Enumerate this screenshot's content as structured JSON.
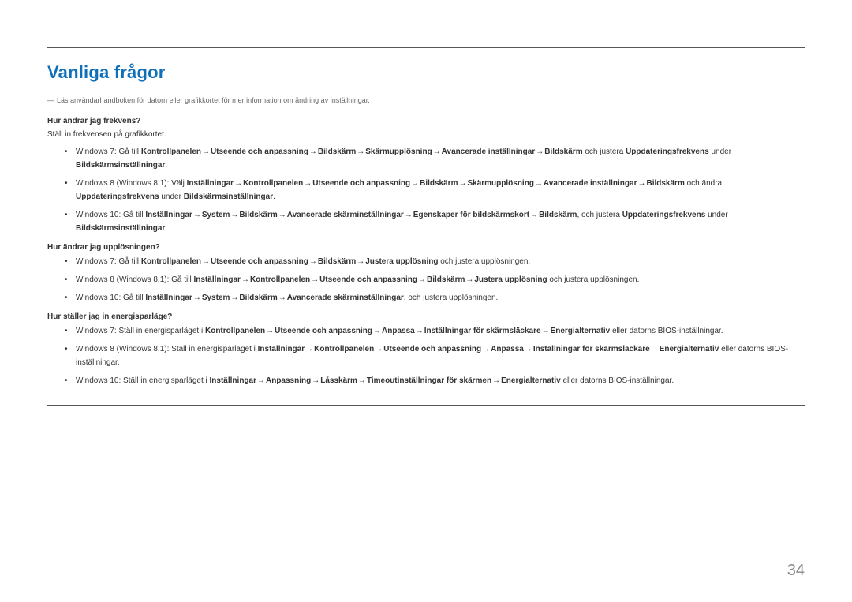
{
  "title": "Vanliga frågor",
  "note": "Läs användarhandboken för datorn eller grafikkortet för mer information om ändring av inställningar.",
  "arrow": "→",
  "sections": [
    {
      "question": "Hur ändrar jag frekvens?",
      "intro": "Ställ in frekvensen på grafikkortet.",
      "items": [
        {
          "prefix": "Windows 7: Gå till ",
          "path": [
            "Kontrollpanelen",
            "Utseende och anpassning",
            "Bildskärm",
            "Skärmupplösning",
            "Avancerade inställningar",
            "Bildskärm"
          ],
          "mid": " och justera ",
          "target": "Uppdateringsfrekvens",
          "mid2": " under ",
          "trail_bold": "Bildskärmsinställningar",
          "suffix": "."
        },
        {
          "prefix": "Windows 8 (Windows 8.1): Välj ",
          "path": [
            "Inställningar",
            "Kontrollpanelen",
            "Utseende och anpassning",
            "Bildskärm",
            "Skärmupplösning",
            "Avancerade inställningar",
            "Bildskärm"
          ],
          "mid": " och ändra ",
          "target": "Uppdateringsfrekvens",
          "mid2": " under ",
          "trail_bold": "Bildskärmsinställningar",
          "suffix": "."
        },
        {
          "prefix": "Windows 10: Gå till ",
          "path": [
            "Inställningar",
            "System",
            "Bildskärm",
            "Avancerade skärminställningar",
            "Egenskaper för bildskärmskort",
            "Bildskärm"
          ],
          "mid": ", och justera ",
          "target": "Uppdateringsfrekvens",
          "mid2": " under ",
          "trail_bold": "Bildskärmsinställningar",
          "suffix": "."
        }
      ]
    },
    {
      "question": "Hur ändrar jag upplösningen?",
      "intro": "",
      "items": [
        {
          "prefix": "Windows 7: Gå till ",
          "path": [
            "Kontrollpanelen",
            "Utseende och anpassning",
            "Bildskärm",
            "Justera upplösning"
          ],
          "mid": " och justera upplösningen.",
          "target": "",
          "mid2": "",
          "trail_bold": "",
          "suffix": ""
        },
        {
          "prefix": "Windows 8 (Windows 8.1): Gå till ",
          "path": [
            "Inställningar",
            "Kontrollpanelen",
            "Utseende och anpassning",
            "Bildskärm",
            "Justera upplösning"
          ],
          "mid": " och justera upplösningen.",
          "target": "",
          "mid2": "",
          "trail_bold": "",
          "suffix": ""
        },
        {
          "prefix": "Windows 10: Gå till ",
          "path": [
            "Inställningar",
            "System",
            "Bildskärm",
            "Avancerade skärminställningar"
          ],
          "mid": ", och justera upplösningen.",
          "target": "",
          "mid2": "",
          "trail_bold": "",
          "suffix": ""
        }
      ]
    },
    {
      "question": "Hur ställer jag in energisparläge?",
      "intro": "",
      "items": [
        {
          "prefix": "Windows 7: Ställ in energisparläget i ",
          "path": [
            "Kontrollpanelen",
            "Utseende och anpassning",
            "Anpassa",
            "Inställningar för skärmsläckare",
            "Energialternativ"
          ],
          "mid": " eller datorns BIOS-inställningar.",
          "target": "",
          "mid2": "",
          "trail_bold": "",
          "suffix": ""
        },
        {
          "prefix": "Windows 8 (Windows 8.1): Ställ in energisparläget i ",
          "path": [
            "Inställningar",
            "Kontrollpanelen",
            "Utseende och anpassning",
            "Anpassa",
            "Inställningar för skärmsläckare",
            "Energialternativ"
          ],
          "mid": " eller datorns BIOS-inställningar.",
          "target": "",
          "mid2": "",
          "trail_bold": "",
          "suffix": ""
        },
        {
          "prefix": "Windows 10: Ställ in energisparläget i ",
          "path": [
            "Inställningar",
            "Anpassning",
            "Låsskärm",
            "Timeoutinställningar för skärmen",
            "Energialternativ"
          ],
          "mid": " eller datorns BIOS-inställningar.",
          "target": "",
          "mid2": "",
          "trail_bold": "",
          "suffix": ""
        }
      ]
    }
  ],
  "page_number": "34"
}
